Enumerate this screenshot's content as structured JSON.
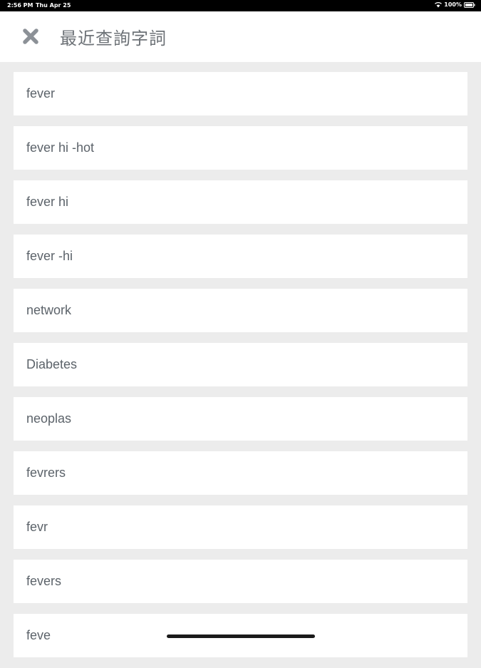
{
  "status_bar": {
    "time": "2:56 PM",
    "date": "Thu Apr 25",
    "battery": "100%"
  },
  "header": {
    "title": "最近查詢字詞",
    "close_icon": "close-icon"
  },
  "recent_searches": [
    "fever",
    "fever hi -hot",
    "fever hi",
    "fever -hi",
    "network",
    "Diabetes",
    "neoplas",
    "fevrers",
    "fevr",
    "fevers",
    "feve"
  ],
  "colors": {
    "background": "#ececec",
    "card": "#ffffff",
    "text": "#5c636a",
    "title": "#6d7277",
    "icon": "#8c9197"
  }
}
